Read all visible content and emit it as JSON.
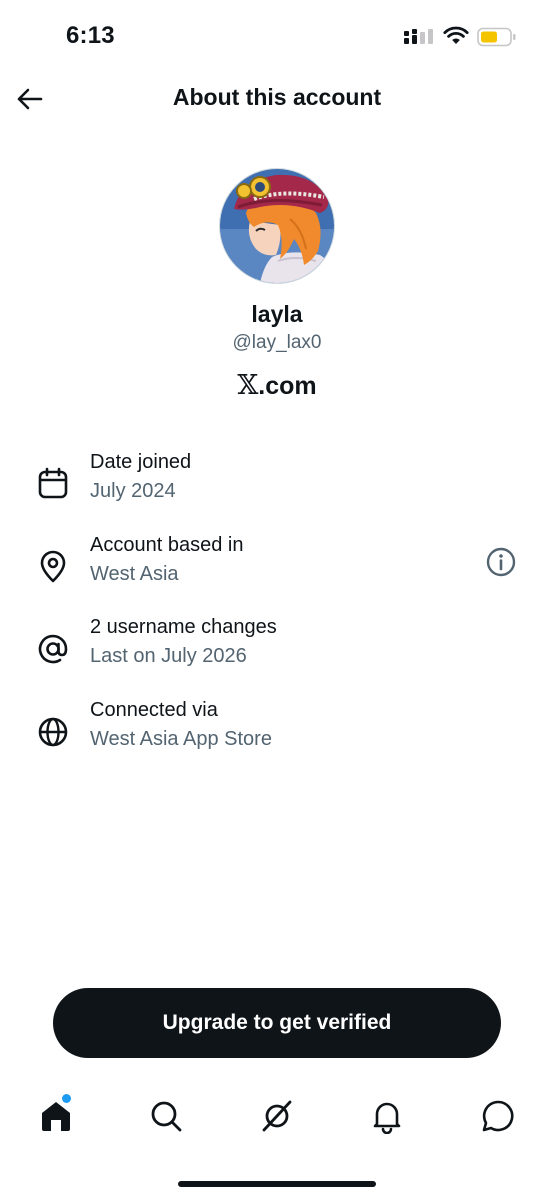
{
  "status_bar": {
    "time": "6:13"
  },
  "header": {
    "title": "About this account"
  },
  "profile": {
    "name": "layla",
    "handle": "@lay_lax0",
    "site_logo": "𝕏",
    "site_suffix": ".com"
  },
  "rows": [
    {
      "label": "Date joined",
      "value": "July 2024",
      "icon": "calendar-icon"
    },
    {
      "label": "Account based in",
      "value": "West Asia",
      "icon": "location-pin-icon"
    },
    {
      "label": "2 username changes",
      "value": "Last on July 2026",
      "icon": "at-sign-icon"
    },
    {
      "label": "Connected via",
      "value": "West Asia App Store",
      "icon": "globe-icon"
    }
  ],
  "upgrade_button": {
    "label": "Upgrade to get verified"
  },
  "tab_bar": {
    "items": [
      "home-icon",
      "search-icon",
      "grok-icon",
      "notifications-bell-icon",
      "messages-icon"
    ]
  },
  "colors": {
    "text_primary": "#0f1419",
    "text_secondary": "#536471",
    "accent": "#1d9bf0",
    "button_bg": "#0f1419",
    "battery": "#f5c400"
  }
}
